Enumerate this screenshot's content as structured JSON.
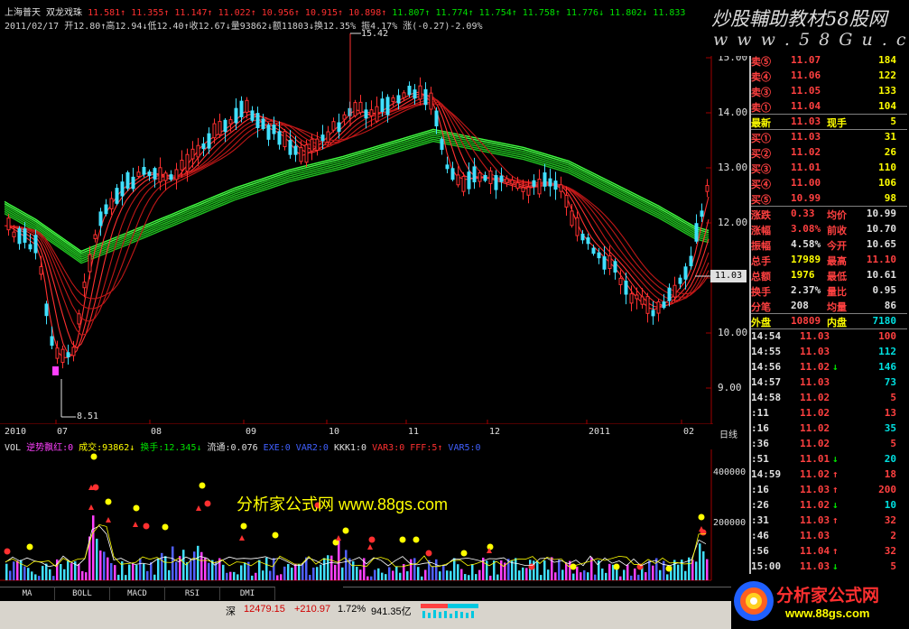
{
  "header": {
    "name": "上海普天",
    "indicator": "双龙戏珠",
    "ma_values": [
      {
        "v": "11.581",
        "d": "↑"
      },
      {
        "v": "11.355",
        "d": "↑"
      },
      {
        "v": "11.147",
        "d": "↑"
      },
      {
        "v": "11.022",
        "d": "↑"
      },
      {
        "v": "10.956",
        "d": "↑"
      },
      {
        "v": "10.915",
        "d": "↑"
      },
      {
        "v": "10.898",
        "d": "↑"
      },
      {
        "v": "11.807",
        "d": "↑"
      },
      {
        "v": "11.774",
        "d": "↑"
      },
      {
        "v": "11.754",
        "d": "↑"
      },
      {
        "v": "11.758",
        "d": "↑"
      },
      {
        "v": "11.776",
        "d": "↓"
      },
      {
        "v": "11.802",
        "d": "↓"
      },
      {
        "v": "11.833",
        "d": ""
      }
    ],
    "line2": "2011/02/17 开12.80↑高12.94↓低12.40↑收12.67↓量93862↓额11803↓换12.35% 振4.17% 涨(-0.27)-2.09%"
  },
  "banner": {
    "line1": "炒股輔助教材58股网",
    "line2": "w w w . 5 8 G u . c o m"
  },
  "price_axis": [
    "15.00",
    "14.00",
    "13.00",
    "12.00",
    "11.00",
    "10.00",
    "9.00"
  ],
  "price_flag": "11.03",
  "high_label": "15.42",
  "low_label": "8.51",
  "date_axis": [
    "2010",
    "07",
    "08",
    "09",
    "10",
    "11",
    "12",
    "2011",
    "02"
  ],
  "period_label": "日线",
  "volume_header": {
    "label": "VOL",
    "items": [
      {
        "t": "逆势飘红:0",
        "c": "mag"
      },
      {
        "t": "成交:93862↓",
        "c": "yel"
      },
      {
        "t": "换手:12.345↓",
        "c": "grn"
      },
      {
        "t": "流通:0.076",
        "c": "wht"
      },
      {
        "t": "EXE:0",
        "c": "blu"
      },
      {
        "t": "VAR2:0",
        "c": "blu"
      },
      {
        "t": "KKK1:0",
        "c": "wht"
      },
      {
        "t": "VAR3:0",
        "c": "red"
      },
      {
        "t": "FFF:5↑",
        "c": "red"
      },
      {
        "t": "VAR5:0",
        "c": "blu"
      }
    ]
  },
  "volume_axis": [
    "400000",
    "200000"
  ],
  "watermark": "分析家公式网 www.88gs.com",
  "tabs": [
    "MA",
    "BOLL",
    "MACD",
    "RSI",
    "DMI"
  ],
  "status_bar": {
    "market": "深",
    "index": "12479.15",
    "change": "+210.97",
    "pct": "1.72%",
    "amount": "941.35亿"
  },
  "quote": {
    "sell": [
      {
        "label": "卖⑤",
        "price": "11.07",
        "vol": "184"
      },
      {
        "label": "卖④",
        "price": "11.06",
        "vol": "122"
      },
      {
        "label": "卖③",
        "price": "11.05",
        "vol": "133"
      },
      {
        "label": "卖①",
        "price": "11.04",
        "vol": "104"
      }
    ],
    "latest": {
      "label": "最新",
      "price": "11.03",
      "label2": "现手",
      "vol": "5"
    },
    "buy": [
      {
        "label": "买①",
        "price": "11.03",
        "vol": "31"
      },
      {
        "label": "买②",
        "price": "11.02",
        "vol": "26"
      },
      {
        "label": "买③",
        "price": "11.01",
        "vol": "110"
      },
      {
        "label": "买④",
        "price": "11.00",
        "vol": "106"
      },
      {
        "label": "买⑤",
        "price": "10.99",
        "vol": "98"
      }
    ],
    "stats": [
      {
        "l1": "涨跌",
        "v1": "0.33",
        "l2": "均价",
        "v2": "10.99"
      },
      {
        "l1": "涨幅",
        "v1": "3.08%",
        "l2": "前收",
        "v2": "10.70"
      },
      {
        "l1": "振幅",
        "v1": "4.58%",
        "l2": "今开",
        "v2": "10.65"
      },
      {
        "l1": "总手",
        "v1": "17989",
        "l2": "最高",
        "v2": "11.10"
      },
      {
        "l1": "总额",
        "v1": "1976",
        "l2": "最低",
        "v2": "10.61"
      },
      {
        "l1": "换手",
        "v1": "2.37%",
        "l2": "量比",
        "v2": "0.95"
      },
      {
        "l1": "分笔",
        "v1": "208",
        "l2": "均量",
        "v2": "86"
      }
    ],
    "outer": {
      "l1": "外盘",
      "v1": "10809",
      "l2": "内盘",
      "v2": "7180"
    },
    "ticks": [
      {
        "t": "14:54",
        "p": "11.03",
        "a": "",
        "v": "100",
        "vc": "red"
      },
      {
        "t": "14:55",
        "p": "11.03",
        "a": "",
        "v": "112",
        "vc": "cyan"
      },
      {
        "t": "14:56",
        "p": "11.02",
        "a": "↓",
        "v": "146",
        "vc": "cyan"
      },
      {
        "t": "14:57",
        "p": "11.03",
        "a": "",
        "v": "73",
        "vc": "cyan"
      },
      {
        "t": "14:58",
        "p": "11.02",
        "a": "",
        "v": "5",
        "vc": "red"
      },
      {
        "t": ":11",
        "p": "11.02",
        "a": "",
        "v": "13",
        "vc": "red"
      },
      {
        "t": ":16",
        "p": "11.02",
        "a": "",
        "v": "35",
        "vc": "cyan"
      },
      {
        "t": ":36",
        "p": "11.02",
        "a": "",
        "v": "5",
        "vc": "red"
      },
      {
        "t": ":51",
        "p": "11.01",
        "a": "↓",
        "v": "20",
        "vc": "cyan"
      },
      {
        "t": "14:59",
        "p": "11.02",
        "a": "↑",
        "v": "18",
        "vc": "red"
      },
      {
        "t": ":16",
        "p": "11.03",
        "a": "↑",
        "v": "200",
        "vc": "red"
      },
      {
        "t": ":26",
        "p": "11.02",
        "a": "↓",
        "v": "10",
        "vc": "cyan"
      },
      {
        "t": ":31",
        "p": "11.03",
        "a": "↑",
        "v": "32",
        "vc": "red"
      },
      {
        "t": ":46",
        "p": "11.03",
        "a": "",
        "v": "2",
        "vc": "red"
      },
      {
        "t": ":56",
        "p": "11.04",
        "a": "↑",
        "v": "32",
        "vc": "red"
      },
      {
        "t": "15:00",
        "p": "11.03",
        "a": "↓",
        "v": "5",
        "vc": "red"
      }
    ]
  },
  "brand": {
    "line1": "分析家公式网",
    "line2": "www.88gs.com"
  }
}
